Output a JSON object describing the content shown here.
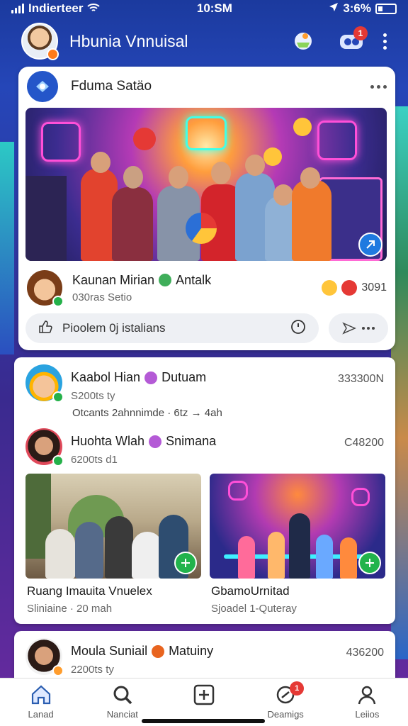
{
  "status_bar": {
    "carrier": "Indierteer",
    "time": "10:SM",
    "battery": "3:6%"
  },
  "header": {
    "title": "Hbunia Vnnuisal",
    "notification_count": "1"
  },
  "featured_card": {
    "title": "Fduma Satäo",
    "author": {
      "name": "Kaunan Mirian",
      "tag": "Antalk",
      "sub": "030ras Setio"
    },
    "reaction_count": "3091",
    "comment_placeholder": "Pioolem 0j istalians"
  },
  "feed": {
    "posts": [
      {
        "name": "Kaabol Hian",
        "tag": "Dutuam",
        "sub": "S200ts ty",
        "count": "333300N",
        "meta": "Otcants 2ahnnimde · 6tz → 4ah"
      },
      {
        "name": "Huohta Wlah",
        "tag": "Snimana",
        "sub": "6200ts d1",
        "count": "C48200"
      }
    ],
    "thumbnails": [
      {
        "title": "Ruang Imauita Vnuelex",
        "sub": "Sliniaine · 20 mah"
      },
      {
        "title": "GbamoUrnitad",
        "sub": "Sjoadel 1-Quteray"
      }
    ]
  },
  "last_post": {
    "name": "Moula Suniail",
    "tag": "Matuiny",
    "sub": "2200ts ty",
    "count": "436200"
  },
  "bottom_nav": [
    {
      "label": "Lanad",
      "icon": "home-icon"
    },
    {
      "label": "Nanciat",
      "icon": "search-icon"
    },
    {
      "label": "",
      "icon": "add-icon"
    },
    {
      "label": "Deamigs",
      "icon": "notification-icon",
      "badge": "1"
    },
    {
      "label": "Leiios",
      "icon": "profile-icon"
    }
  ],
  "colors": {
    "brand": "#2546b8",
    "accent": "#1f7ae0",
    "badge": "#e53935",
    "online": "#25b14a"
  }
}
